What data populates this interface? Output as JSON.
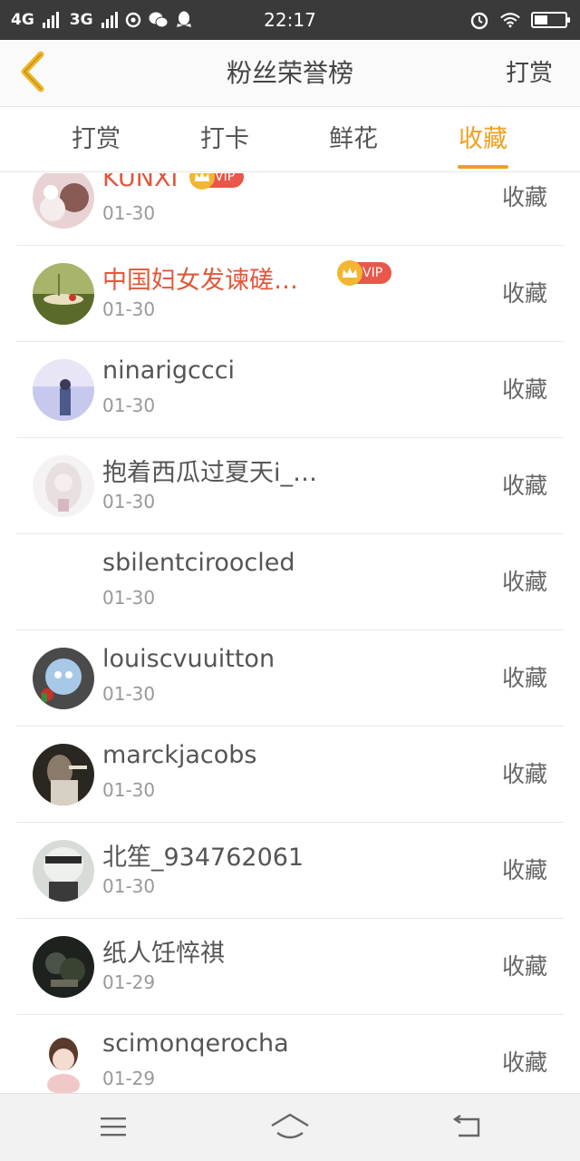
{
  "status_bar": {
    "network1": "4G",
    "network2": "3G",
    "time": "22:17"
  },
  "header": {
    "title": "粉丝荣誉榜",
    "action_label": "打赏"
  },
  "tabs": [
    {
      "label": "打赏",
      "active": false
    },
    {
      "label": "打卡",
      "active": false
    },
    {
      "label": "鲜花",
      "active": false
    },
    {
      "label": "收藏",
      "active": true
    }
  ],
  "accent_color": "#f0a020",
  "vip_name_color": "#e2573a",
  "list": {
    "items": [
      {
        "name": "KUNXI",
        "date": "01-30",
        "vip": true,
        "vip_label": "VIP",
        "action": "收藏"
      },
      {
        "name": "中国妇女发谏磋…",
        "date": "01-30",
        "vip": true,
        "vip_label": "VIP",
        "action": "收藏"
      },
      {
        "name": "ninarigccci",
        "date": "01-30",
        "vip": false,
        "action": "收藏"
      },
      {
        "name": "抱着西瓜过夏天i_…",
        "date": "01-30",
        "vip": false,
        "action": "收藏"
      },
      {
        "name": "sbilentciroocled",
        "date": "01-30",
        "vip": false,
        "action": "收藏"
      },
      {
        "name": "louiscvuuitton",
        "date": "01-30",
        "vip": false,
        "action": "收藏"
      },
      {
        "name": "marckjacobs",
        "date": "01-30",
        "vip": false,
        "action": "收藏"
      },
      {
        "name": "北笙_934762061",
        "date": "01-30",
        "vip": false,
        "action": "收藏"
      },
      {
        "name": "纸人饪悴祺",
        "date": "01-29",
        "vip": false,
        "action": "收藏"
      },
      {
        "name": "scimonqerocha",
        "date": "01-29",
        "vip": false,
        "action": "收藏"
      }
    ]
  },
  "icons": {
    "back": "chevron-left-icon",
    "menu": "menu-icon",
    "home": "home-icon",
    "return": "return-icon"
  }
}
